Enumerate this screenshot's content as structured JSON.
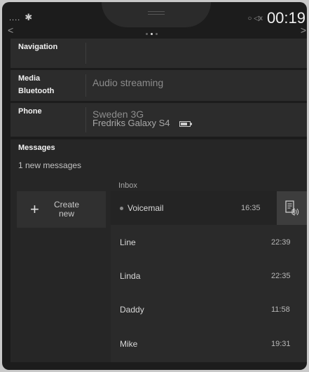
{
  "status": {
    "signal": "....",
    "bluetooth": "✱",
    "indicators": "○ ◁x",
    "time": "00:19"
  },
  "pager": {
    "pages": 3,
    "active": 2
  },
  "rows": {
    "navigation": {
      "label": "Navigation"
    },
    "media": {
      "label_1": "Media",
      "label_2": "Bluetooth",
      "value": "Audio streaming"
    },
    "phone": {
      "label": "Phone",
      "network": "Sweden 3G",
      "device": "Fredriks Galaxy S4"
    },
    "messages": {
      "label": "Messages",
      "count_text": "1 new messages"
    }
  },
  "create": {
    "label_1": "Create",
    "label_2": "new"
  },
  "inbox": {
    "label": "Inbox",
    "messages": [
      {
        "name": "Voicemail",
        "time": "16:35",
        "unread": true
      },
      {
        "name": "Line",
        "time": "22:39",
        "unread": false
      },
      {
        "name": "Linda",
        "time": "22:35",
        "unread": false
      },
      {
        "name": "Daddy",
        "time": "11:58",
        "unread": false
      },
      {
        "name": "Mike",
        "time": "19:31",
        "unread": false
      }
    ]
  },
  "icons": {
    "left_chevron": "chevron-left-icon",
    "right_chevron": "chevron-right-icon",
    "battery": "battery-icon",
    "plus": "plus-icon",
    "play_voicemail": "read-aloud-icon"
  }
}
